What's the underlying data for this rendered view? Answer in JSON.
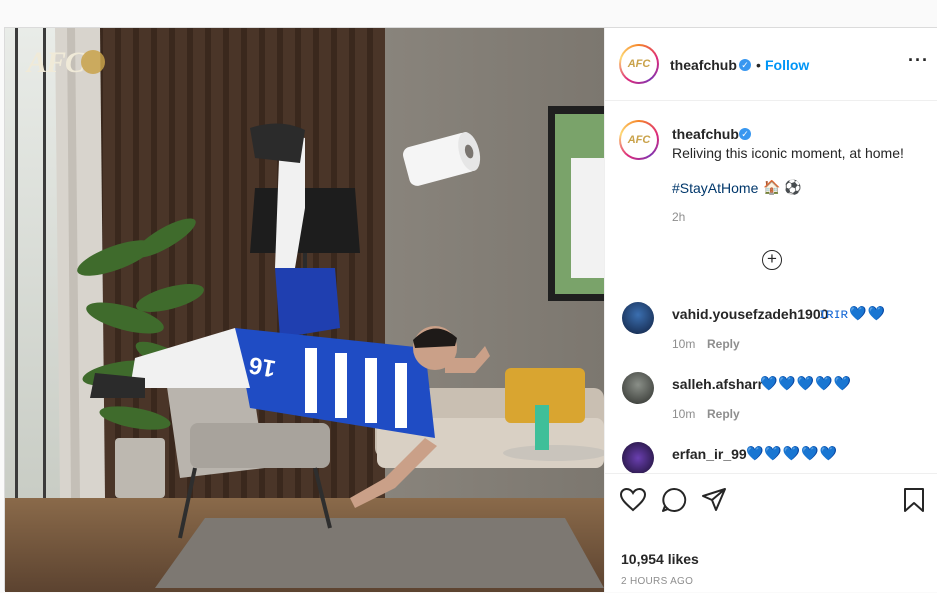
{
  "post": {
    "logo_text": "AFC",
    "jersey_number": "16",
    "account": {
      "username": "theafchub",
      "follow_label": "Follow",
      "separator": "•",
      "more_icon": "more-horizontal-icon"
    },
    "caption": {
      "username": "theafchub",
      "text": "Reliving this iconic moment, at home!",
      "hashtag": "#StayAtHome",
      "emoji": "🏠 ⚽",
      "time": "2h",
      "load_more_icon": "plus-circle-icon"
    },
    "comments": [
      {
        "username": "vahid.yousefzadeh1900",
        "text": "ɪʀɪʀ💙💙",
        "time": "10m",
        "reply_label": "Reply"
      },
      {
        "username": "salleh.afsharr",
        "text": "💙💙💙💙💙",
        "time": "10m",
        "reply_label": "Reply"
      },
      {
        "username": "erfan_ir_99",
        "text": "💙💙💙💙💙"
      }
    ],
    "likes": "10,954 likes",
    "posted_ago": "2 HOURS AGO",
    "icons": [
      "heart-icon",
      "comment-icon",
      "share-icon",
      "bookmark-icon"
    ],
    "colors": {
      "follow": "#0095f6",
      "hashtag": "#00376b",
      "verified": "#3897f0",
      "hearts": "#1a6bd6"
    }
  }
}
